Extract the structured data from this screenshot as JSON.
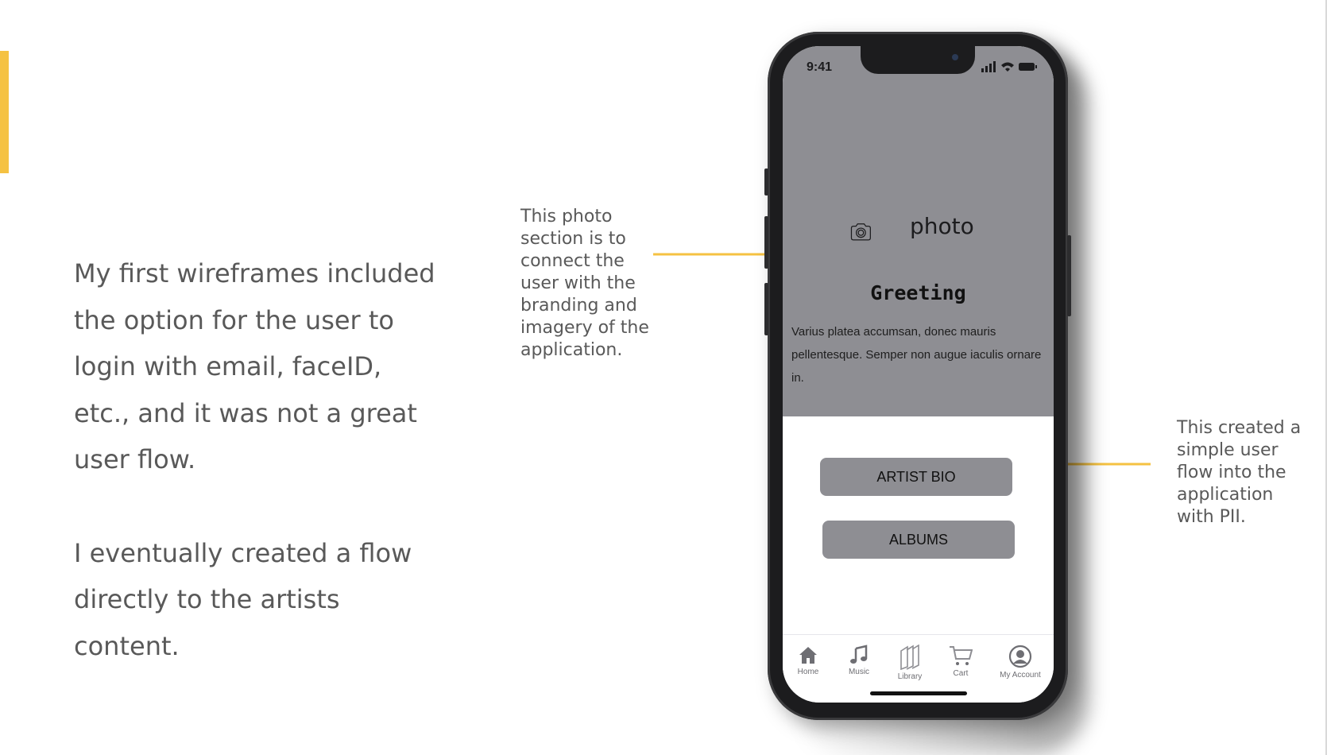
{
  "slide": {
    "paragraph_1": "My first wireframes included the option for the user to login with email, faceID, etc., and it was not a great user flow.",
    "paragraph_2": "I eventually created a flow directly to the artists content.",
    "annotation_left": "This photo\nsection is to\nconnect the\nuser with the\nbranding and\nimagery of the\napplication.",
    "annotation_right": "This created a\nsimple user\nflow into the\napplication\nwith PII.",
    "accent_color": "#f5c242"
  },
  "phone": {
    "status_time": "9:41",
    "photo_label": "photo",
    "greeting": "Greeting",
    "body": "Varius platea accumsan, donec mauris pellentesque. Semper non augue iaculis ornare in.",
    "buttons": {
      "artist_bio": "ARTIST BIO",
      "albums": "ALBUMS"
    },
    "tabs": [
      {
        "label": "Home",
        "icon": "home-icon"
      },
      {
        "label": "Music",
        "icon": "music-note-icon"
      },
      {
        "label": "Library",
        "icon": "library-icon"
      },
      {
        "label": "Cart",
        "icon": "cart-icon"
      },
      {
        "label": "My Account",
        "icon": "account-icon"
      }
    ]
  }
}
